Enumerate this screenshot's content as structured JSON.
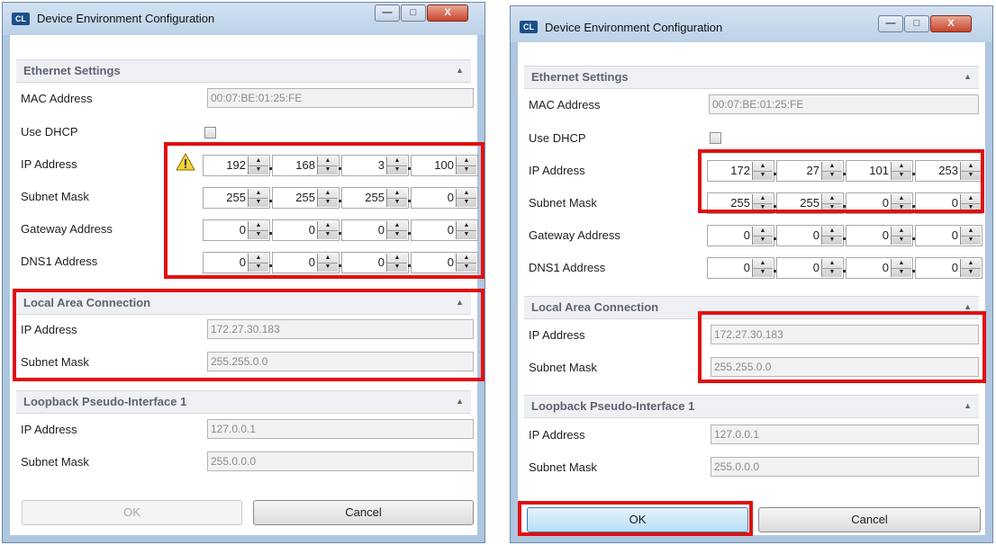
{
  "left": {
    "title": "Device Environment Configuration",
    "app_icon": "CL",
    "window_controls": {
      "minimize": "—",
      "maximize": "□",
      "close": "X"
    },
    "ethernet": {
      "header": "Ethernet Settings",
      "mac_label": "MAC Address",
      "mac_value": "00:07:BE:01:25:FE",
      "dhcp_label": "Use DHCP",
      "ip_label": "IP Address",
      "ip": [
        "192",
        "168",
        "3",
        "100"
      ],
      "subnet_label": "Subnet Mask",
      "subnet": [
        "255",
        "255",
        "255",
        "0"
      ],
      "gateway_label": "Gateway Address",
      "gateway": [
        "0",
        "0",
        "0",
        "0"
      ],
      "dns_label": "DNS1 Address",
      "dns": [
        "0",
        "0",
        "0",
        "0"
      ]
    },
    "lan": {
      "header": "Local Area Connection",
      "ip_label": "IP Address",
      "ip_value": "172.27.30.183",
      "subnet_label": "Subnet Mask",
      "subnet_value": "255.255.0.0"
    },
    "loopback": {
      "header": "Loopback Pseudo-Interface 1",
      "ip_label": "IP Address",
      "ip_value": "127.0.0.1",
      "subnet_label": "Subnet Mask",
      "subnet_value": "255.0.0.0"
    },
    "ok": "OK",
    "cancel": "Cancel"
  },
  "right": {
    "title": "Device Environment Configuration",
    "app_icon": "CL",
    "window_controls": {
      "minimize": "—",
      "maximize": "□",
      "close": "X"
    },
    "ethernet": {
      "header": "Ethernet Settings",
      "mac_label": "MAC Address",
      "mac_value": "00:07:BE:01:25:FE",
      "dhcp_label": "Use DHCP",
      "ip_label": "IP Address",
      "ip": [
        "172",
        "27",
        "101",
        "253"
      ],
      "subnet_label": "Subnet Mask",
      "subnet": [
        "255",
        "255",
        "0",
        "0"
      ],
      "gateway_label": "Gateway Address",
      "gateway": [
        "0",
        "0",
        "0",
        "0"
      ],
      "dns_label": "DNS1 Address",
      "dns": [
        "0",
        "0",
        "0",
        "0"
      ]
    },
    "lan": {
      "header": "Local Area Connection",
      "ip_label": "IP Address",
      "ip_value": "172.27.30.183",
      "subnet_label": "Subnet Mask",
      "subnet_value": "255.255.0.0"
    },
    "loopback": {
      "header": "Loopback Pseudo-Interface 1",
      "ip_label": "IP Address",
      "ip_value": "127.0.0.1",
      "subnet_label": "Subnet Mask",
      "subnet_value": "255.0.0.0"
    },
    "ok": "OK",
    "cancel": "Cancel"
  },
  "colors": {
    "highlight": "#e01010",
    "title_bar": "#bcd1e8",
    "close_button": "#c7442a"
  }
}
